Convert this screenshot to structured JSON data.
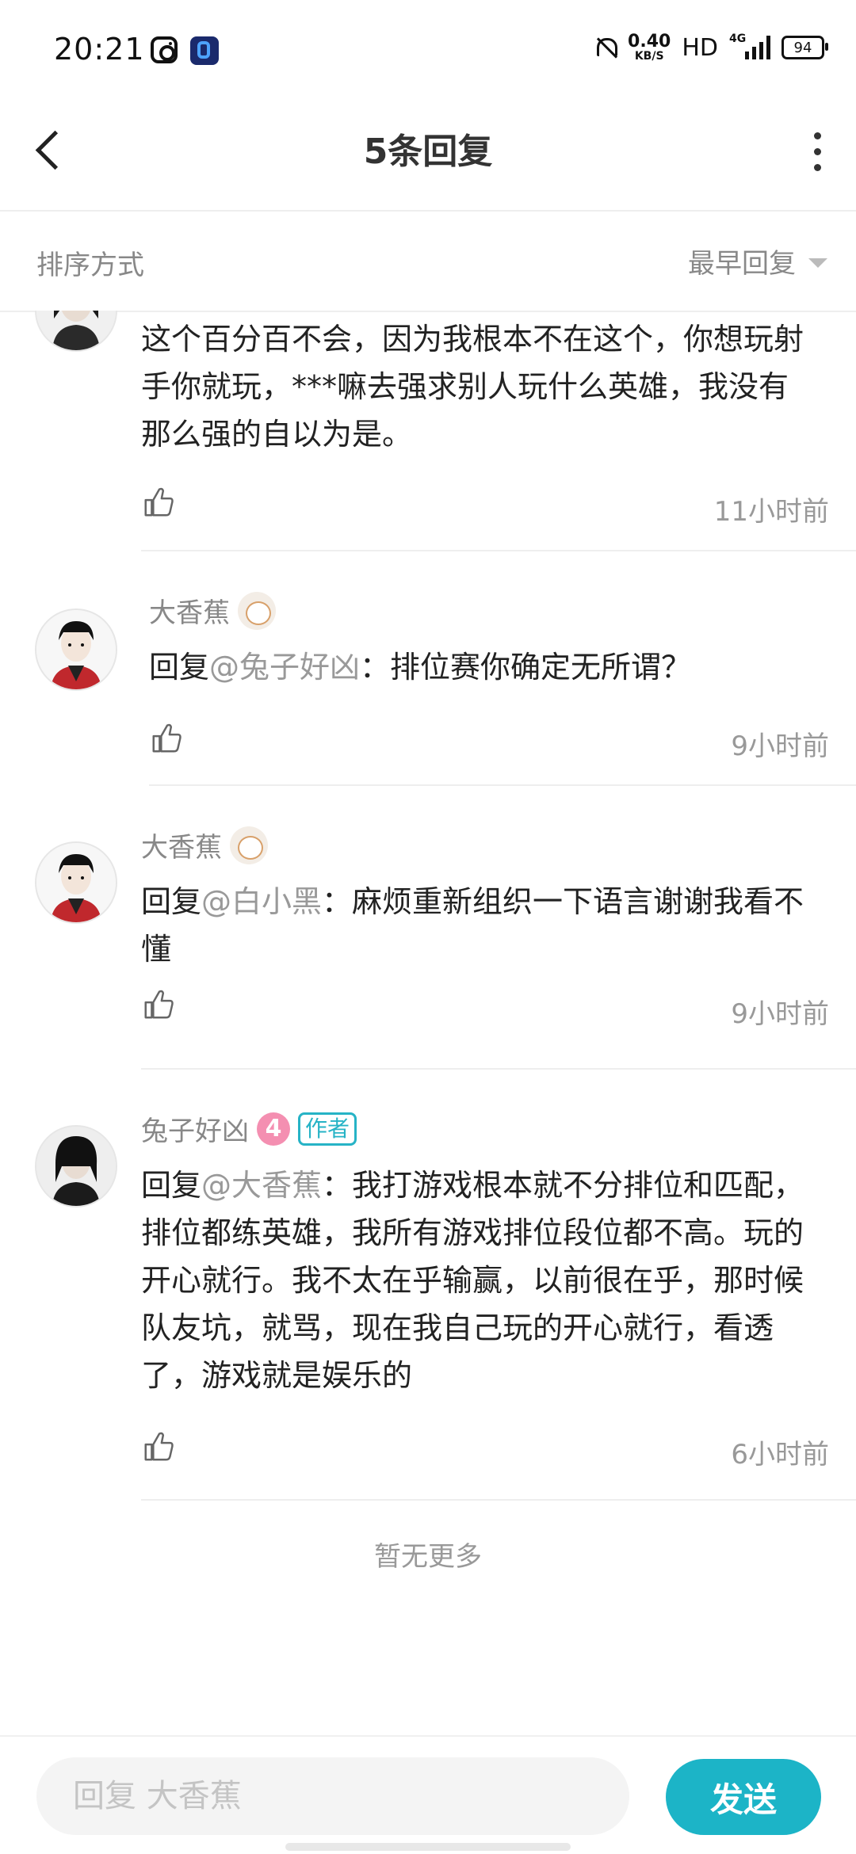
{
  "status_bar": {
    "time": "20:21",
    "speed_value": "0.40",
    "speed_unit": "KB/S",
    "hd": "HD",
    "network": "4G",
    "battery": "94",
    "icons": [
      "instagram-icon",
      "app-b-icon",
      "bell-muted-icon",
      "signal-icon",
      "battery-icon"
    ]
  },
  "header": {
    "title": "5条回复",
    "back_icon": "chevron-left-icon",
    "more_icon": "more-vertical-icon"
  },
  "sort": {
    "label": "排序方式",
    "value": "最早回复"
  },
  "comments": [
    {
      "name": "",
      "text": "这个百分百不会，因为我根本不在这个，你想玩射手你就玩，***嘛去强求别人玩什么英雄，我没有那么强的自以为是。",
      "time": "11小时前"
    },
    {
      "name": "大香蕉",
      "reply_prefix": "回复",
      "mention": "@兔子好凶",
      "text": "：排位赛你确定无所谓？",
      "time": "9小时前"
    },
    {
      "name": "大香蕉",
      "reply_prefix": "回复",
      "mention": "@白小黑",
      "text": "：麻烦重新组织一下语言谢谢我看不懂",
      "time": "9小时前"
    },
    {
      "name": "兔子好凶",
      "level": "4",
      "author_badge": "作者",
      "reply_prefix": "回复",
      "mention": "@大香蕉",
      "text": "：我打游戏根本就不分排位和匹配，排位都练英雄，我所有游戏排位段位都不高。玩的开心就行。我不太在乎输赢，以前很在乎，那时候队友坑，就骂，现在我自己玩的开心就行，看透了，游戏就是娱乐的",
      "time": "6小时前"
    }
  ],
  "footer_note": "暂无更多",
  "reply_bar": {
    "placeholder": "回复 大香蕉",
    "send_label": "发送"
  },
  "colors": {
    "accent": "#1cb4c7",
    "mention": "#999999",
    "level_badge": "#f48fb1"
  }
}
